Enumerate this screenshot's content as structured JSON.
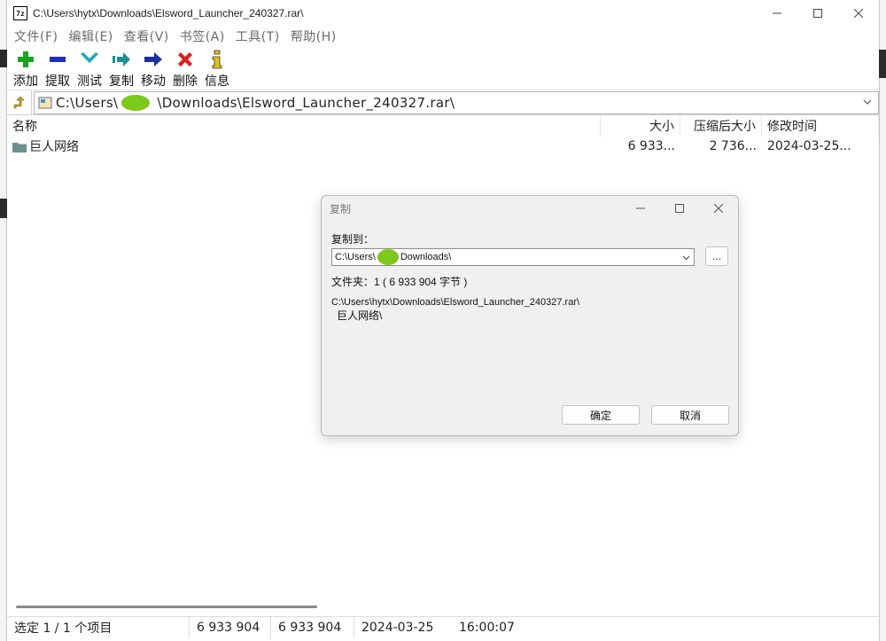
{
  "window": {
    "title": "C:\\Users\\hytx\\Downloads\\Elsword_Launcher_240327.rar\\",
    "app_icon": "7z"
  },
  "menu": [
    "文件(F)",
    "编辑(E)",
    "查看(V)",
    "书签(A)",
    "工具(T)",
    "帮助(H)"
  ],
  "toolbar": [
    {
      "label": "添加",
      "icon": "plus-icon",
      "color": "#1aa321"
    },
    {
      "label": "提取",
      "icon": "minus-icon",
      "color": "#1f2fbf"
    },
    {
      "label": "测试",
      "icon": "check-chevron-icon",
      "color": "#1aa8b8"
    },
    {
      "label": "复制",
      "icon": "copy-arrow-icon",
      "color": "#1a8f8f"
    },
    {
      "label": "移动",
      "icon": "move-arrow-icon",
      "color": "#1a2f9f"
    },
    {
      "label": "删除",
      "icon": "delete-x-icon",
      "color": "#e01c1c"
    },
    {
      "label": "信息",
      "icon": "info-icon",
      "color": "#e0c21a"
    }
  ],
  "address": {
    "path_prefix": "C:\\Users\\",
    "path_suffix": "\\Downloads\\Elsword_Launcher_240327.rar\\"
  },
  "list": {
    "headers": {
      "name": "名称",
      "size": "大小",
      "packed": "压缩后大小",
      "modified": "修改时间"
    },
    "rows": [
      {
        "name": "巨人网络",
        "size": "6 933...",
        "packed": "2 736...",
        "modified": "2024-03-25..."
      }
    ]
  },
  "status": {
    "selected": "选定  1  /  1  个项目",
    "size": "6  933  904",
    "packed": "6  933  904",
    "date": "2024-03-25",
    "time": "16:00:07"
  },
  "dialog": {
    "title": "复制",
    "copy_to_label": "复制到：",
    "dest_prefix": "C:\\Users\\",
    "dest_suffix": "Downloads\\",
    "browse_label": "...",
    "info": "文件夹：1    ( 6 933 904 字节 )",
    "source_path": "C:\\Users\\hytx\\Downloads\\Elsword_Launcher_240327.rar\\",
    "source_item": "巨人网络\\",
    "ok_label": "确定",
    "cancel_label": "取消"
  },
  "colors": {
    "redaction": "#7ec81c",
    "folder": "#6f8f8f"
  }
}
